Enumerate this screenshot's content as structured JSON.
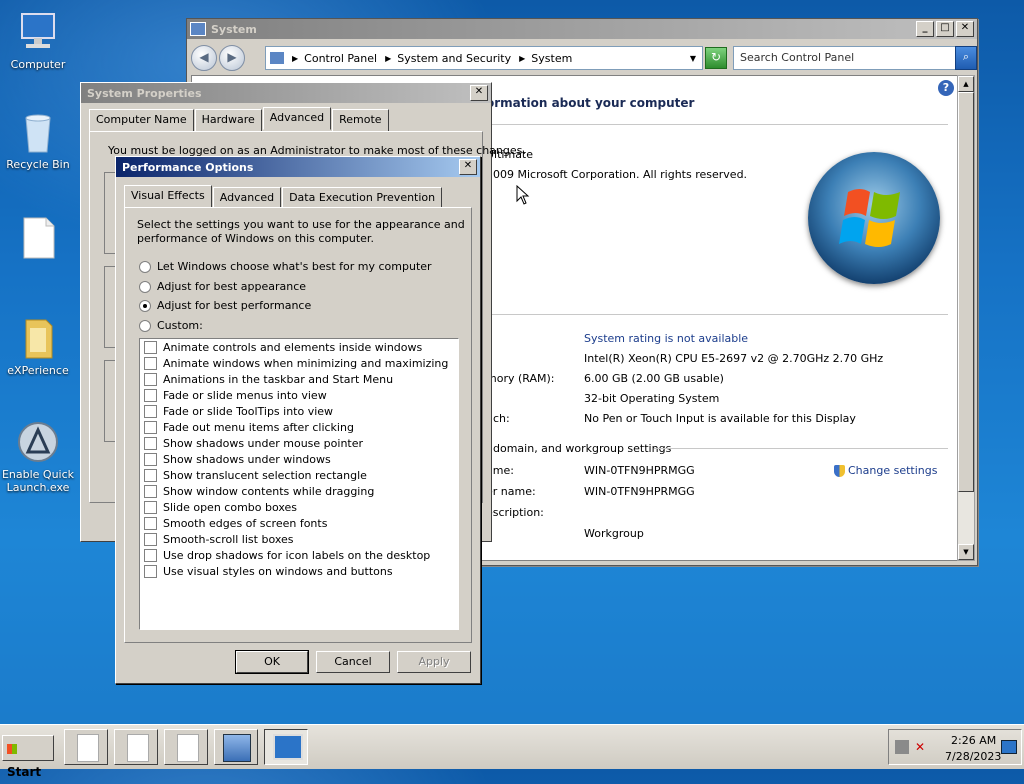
{
  "desktop": {
    "icons": [
      {
        "label": "Computer"
      },
      {
        "label": "Recycle Bin"
      },
      {
        "label": ""
      },
      {
        "label": "eXPerience"
      },
      {
        "label": "Enable Quick Launch.exe"
      }
    ]
  },
  "system_window": {
    "title": "System",
    "breadcrumb": [
      "Control Panel",
      "System and Security",
      "System"
    ],
    "search_placeholder": "Search Control Panel",
    "heading": "ormation about your computer",
    "edition": "Ultimate",
    "copyright": "2009 Microsoft Corporation.  All rights reserved.",
    "rows": [
      {
        "label": "",
        "value": "System rating is not available",
        "link": true
      },
      {
        "label": "",
        "value": "Intel(R) Xeon(R) CPU E5-2697 v2 @ 2.70GHz   2.70 GHz"
      },
      {
        "label": "mory (RAM):",
        "value": "6.00 GB (2.00 GB usable)"
      },
      {
        "label": "",
        "value": "32-bit Operating System"
      },
      {
        "label": "uch:",
        "value": "No Pen or Touch Input is available for this Display"
      }
    ],
    "section2_title": ", domain, and workgroup settings",
    "rows2": [
      {
        "label": "ame:",
        "value": "WIN-0TFN9HPRMGG"
      },
      {
        "label": "er name:",
        "value": "WIN-0TFN9HPRMGG"
      },
      {
        "label": "escription:",
        "value": ""
      },
      {
        "label": "",
        "value": "Workgroup"
      }
    ],
    "change_settings": "Change settings"
  },
  "system_properties": {
    "title": "System Properties",
    "tabs": [
      "Computer Name",
      "Hardware",
      "Advanced",
      "Remote"
    ],
    "notice": "You must be logged on as an Administrator to make most of these changes."
  },
  "performance_options": {
    "title": "Performance Options",
    "tabs": [
      "Visual Effects",
      "Advanced",
      "Data Execution Prevention"
    ],
    "intro_line1": "Select the settings you want to use for the appearance and",
    "intro_line2": "performance of Windows on this computer.",
    "radios": [
      {
        "label": "Let Windows choose what's best for my computer",
        "selected": false
      },
      {
        "label": "Adjust for best appearance",
        "selected": false
      },
      {
        "label": "Adjust for best performance",
        "selected": true
      },
      {
        "label": "Custom:",
        "selected": false
      }
    ],
    "options": [
      "Animate controls and elements inside windows",
      "Animate windows when minimizing and maximizing",
      "Animations in the taskbar and Start Menu",
      "Fade or slide menus into view",
      "Fade or slide ToolTips into view",
      "Fade out menu items after clicking",
      "Show shadows under mouse pointer",
      "Show shadows under windows",
      "Show translucent selection rectangle",
      "Show window contents while dragging",
      "Slide open combo boxes",
      "Smooth edges of screen fonts",
      "Smooth-scroll list boxes",
      "Use drop shadows for icon labels on the desktop",
      "Use visual styles on windows and buttons"
    ],
    "ok": "OK",
    "cancel": "Cancel",
    "apply": "Apply"
  },
  "taskbar": {
    "start": "Start",
    "time": "2:26 AM",
    "date": "7/28/2023"
  },
  "colors": {
    "title_active_start": "#0a246a",
    "title_active_end": "#a6caf0",
    "link_blue": "#1c3d8c"
  }
}
